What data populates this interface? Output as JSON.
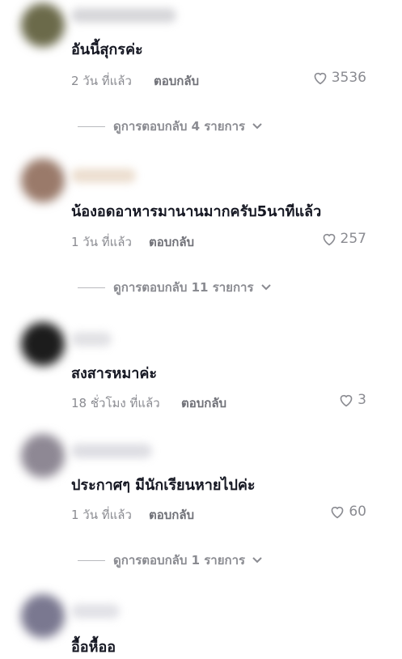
{
  "comments": [
    {
      "text": "อันนี้สุกรค่ะ",
      "time": "2 วัน ที่แล้ว",
      "reply": "ตอบกลับ",
      "likes": "3536",
      "view_replies": "ดูการตอบกลับ 4 รายการ",
      "avatar_color": "#6b6a4a"
    },
    {
      "text": "น้องอดอาหารมานานมากครับ5นาทีแล้ว",
      "time": "1 วัน ที่แล้ว",
      "reply": "ตอบกลับ",
      "likes": "257",
      "view_replies": "ดูการตอบกลับ 11 รายการ",
      "avatar_color": "#9a7a6a"
    },
    {
      "text": "สงสารหมาค่ะ",
      "time": "18 ชั่วโมง ที่แล้ว",
      "reply": "ตอบกลับ",
      "likes": "3",
      "avatar_color": "#1c1c1c"
    },
    {
      "text": "ประกาศๆ มีนักเรียนหายไปค่ะ",
      "time": "1 วัน ที่แล้ว",
      "reply": "ตอบกลับ",
      "likes": "60",
      "view_replies": "ดูการตอบกลับ 1 รายการ",
      "avatar_color": "#8e8894"
    },
    {
      "text": "อื้อหื้ออ",
      "avatar_color": "#7a7890"
    }
  ]
}
